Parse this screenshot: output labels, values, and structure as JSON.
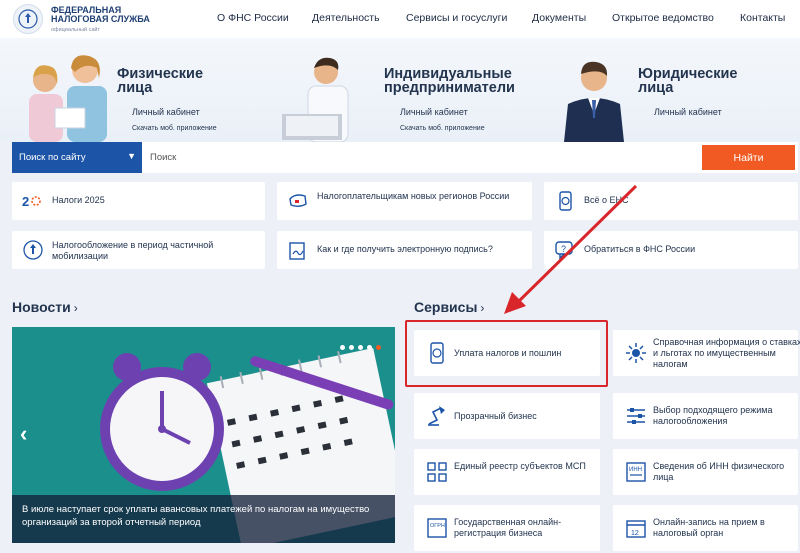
{
  "header": {
    "logo_line1": "ФЕДЕРАЛЬНАЯ",
    "logo_line2": "НАЛОГОВАЯ СЛУЖБА",
    "logo_sub": "официальный сайт",
    "nav": [
      "О ФНС России",
      "Деятельность",
      "Сервисы и госуслуги",
      "Документы",
      "Открытое ведомство",
      "Контакты"
    ]
  },
  "hero": {
    "individuals": {
      "title1": "Физические",
      "title2": "лица",
      "cabinet": "Личный кабинет",
      "app": "Скачать моб. приложение"
    },
    "entrepreneurs": {
      "title1": "Индивидуальные",
      "title2": "предприниматели",
      "cabinet": "Личный кабинет",
      "app": "Скачать моб. приложение"
    },
    "legal": {
      "title1": "Юридические",
      "title2": "лица",
      "cabinet": "Личный кабинет"
    }
  },
  "search": {
    "scope": "Поиск по сайту",
    "placeholder": "Поиск",
    "button": "Найти"
  },
  "quick_links": [
    {
      "text": "Налоги 2025",
      "icon": "taxes-2025-logo"
    },
    {
      "text": "Налогоплательщикам новых регионов России",
      "icon": "russia-map-icon"
    },
    {
      "text": "Всё о ЕНС",
      "icon": "mobile-ruble-icon"
    },
    {
      "text": "Налогообложение в период частичной мобилизации",
      "icon": "emblem-icon"
    },
    {
      "text": "Как и где получить электронную подпись?",
      "icon": "signature-icon"
    },
    {
      "text": "Обратиться в ФНС России",
      "icon": "chat-question-icon"
    }
  ],
  "news": {
    "title": "Новости",
    "caption": "В июле наступает срок уплаты авансовых платежей по налогам на имущество организаций за второй отчетный период"
  },
  "services": {
    "title": "Сервисы",
    "items": [
      {
        "text": "Уплата налогов и пошлин",
        "icon": "payment-phone-icon"
      },
      {
        "text": "Справочная информация о ставках и льготах по имущественным налогам",
        "icon": "reference-info-icon"
      },
      {
        "text": "Прозрачный бизнес",
        "icon": "lamp-icon"
      },
      {
        "text": "Выбор подходящего режима налогообложения",
        "icon": "settings-sliders-icon"
      },
      {
        "text": "Единый реестр субъектов МСП",
        "icon": "registry-icon"
      },
      {
        "text": "Сведения об ИНН физического лица",
        "icon": "inn-card-icon"
      },
      {
        "text": "Государственная онлайн-регистрация бизнеса",
        "icon": "ogrn-doc-icon"
      },
      {
        "text": "Онлайн-запись на прием в налоговый орган",
        "icon": "calendar-icon"
      }
    ]
  },
  "colors": {
    "accent": "#f15a22",
    "brand": "#1c54a8",
    "highlight": "#d9262b"
  }
}
